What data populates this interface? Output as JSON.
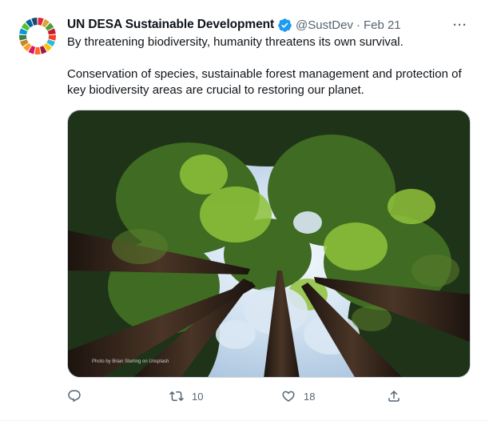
{
  "tweet": {
    "display_name": "UN DESA Sustainable Development",
    "handle": "@SustDev",
    "separator": "·",
    "date": "Feb 21",
    "more": "···",
    "paragraphs": [
      "By threatening biodiversity, humanity threatens its own survival.",
      "Conservation of species, sustainable forest management and protection of key biodiversity areas are crucial to restoring our planet."
    ],
    "media": {
      "credit": "Photo by Brian Sterling on Unsplash"
    },
    "actions": {
      "reply_count": "",
      "retweet_count": "10",
      "like_count": "18"
    }
  },
  "icons": {
    "avatar": "sdg-color-wheel",
    "verified": "verified-badge-icon",
    "reply": "reply-icon",
    "retweet": "retweet-icon",
    "like": "heart-icon",
    "share": "share-icon"
  },
  "colors": {
    "verified": "#1d9bf0",
    "secondary_text": "#536471",
    "primary_text": "#0f1419"
  }
}
